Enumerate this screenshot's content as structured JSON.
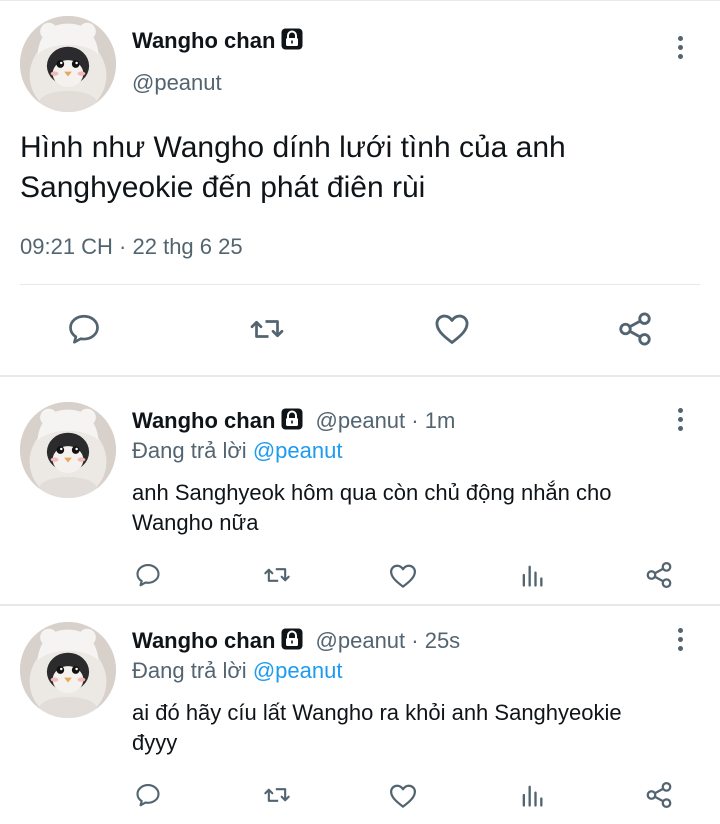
{
  "main_tweet": {
    "author_name": "Wangho chan",
    "handle": "@peanut",
    "text": "Hình như Wangho dính lưới tình của anh Sanghyeokie đến phát điên rùi",
    "timestamp": "09:21 CH · 22 thg 6 25",
    "actions": [
      "reply-icon",
      "retweet-icon",
      "like-icon",
      "share-icon"
    ]
  },
  "replies": [
    {
      "author_name": "Wangho chan",
      "handle_time": "@peanut · 1m",
      "replying_prefix": "Đang trả lời",
      "replying_to": "@peanut",
      "text": "anh Sanghyeok hôm qua còn chủ động nhắn cho Wangho nữa",
      "actions": [
        "reply-icon",
        "retweet-icon",
        "like-icon",
        "analytics-icon",
        "share-icon"
      ]
    },
    {
      "author_name": "Wangho chan",
      "handle_time": "@peanut · 25s",
      "replying_prefix": "Đang trả lời",
      "replying_to": "@peanut",
      "text": "ai đó hãy cíu lất Wangho ra khỏi anh Sanghyeokie đyyy",
      "actions": [
        "reply-icon",
        "retweet-icon",
        "like-icon",
        "analytics-icon",
        "share-icon"
      ]
    }
  ],
  "colors": {
    "text": "#0f1419",
    "muted": "#536471",
    "link": "#1d9bf0",
    "divider": "#e6e9eb"
  }
}
